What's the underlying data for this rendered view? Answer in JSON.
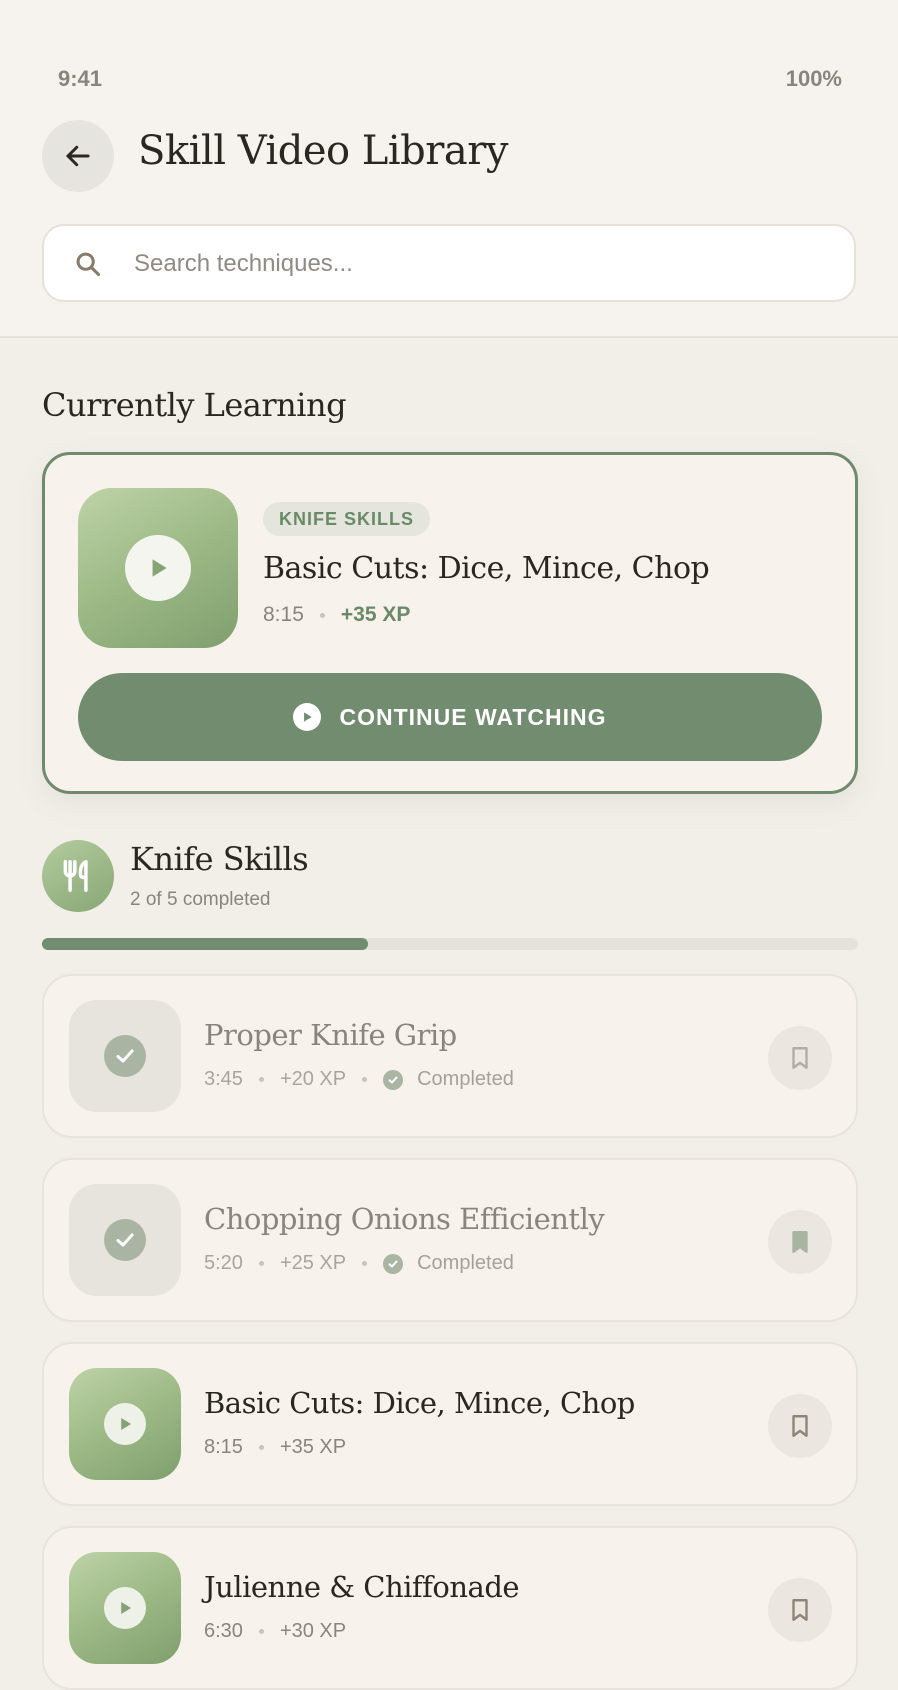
{
  "status": {
    "time": "9:41",
    "battery": "100%"
  },
  "header": {
    "title": "Skill Video Library",
    "back_icon": "arrow-left-icon"
  },
  "search": {
    "placeholder": "Search techniques...",
    "value": ""
  },
  "current": {
    "section_title": "Currently Learning",
    "tag": "KNIFE SKILLS",
    "title": "Basic Cuts: Dice, Mince, Chop",
    "duration": "8:15",
    "xp": "+35 XP",
    "button_label": "CONTINUE WATCHING"
  },
  "category": {
    "title": "Knife Skills",
    "subtitle": "2 of 5 completed",
    "progress": 0.4,
    "icon": "utensils-icon"
  },
  "lessons": [
    {
      "title": "Proper Knife Grip",
      "duration": "3:45",
      "xp": "+20 XP",
      "status": "Completed",
      "bookmarked": false
    },
    {
      "title": "Chopping Onions Efficiently",
      "duration": "5:20",
      "xp": "+25 XP",
      "status": "Completed",
      "bookmarked": true
    },
    {
      "title": "Basic Cuts: Dice, Mince, Chop",
      "duration": "8:15",
      "xp": "+35 XP",
      "bookmarked": false
    },
    {
      "title": "Julienne & Chiffonade",
      "duration": "6:30",
      "xp": "+30 XP",
      "bookmarked": false
    }
  ],
  "colors": {
    "accent": "#728c6f",
    "background": "#f2efe9",
    "card": "#f7f3ec"
  }
}
